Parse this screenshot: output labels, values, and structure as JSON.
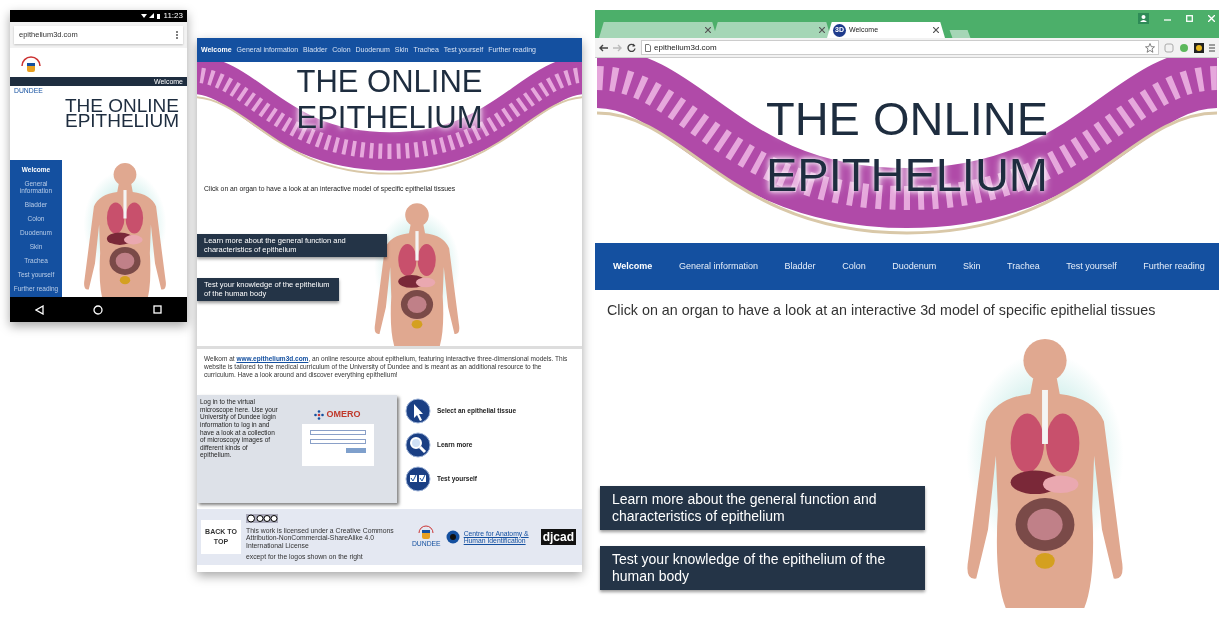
{
  "mobile": {
    "status_time": "11:23",
    "url": "epithelium3d.com",
    "logo_text": "DUNDEE",
    "header_label": "Welcome",
    "title_lines": [
      "THE ONLINE",
      "EPITHELIUM"
    ],
    "menu": [
      {
        "label": "Welcome",
        "selected": true
      },
      {
        "label": "General information",
        "selected": false
      },
      {
        "label": "Bladder",
        "selected": false
      },
      {
        "label": "Colon",
        "selected": false
      },
      {
        "label": "Duodenum",
        "selected": false
      },
      {
        "label": "Skin",
        "selected": false
      },
      {
        "label": "Trachea",
        "selected": false
      },
      {
        "label": "Test yourself",
        "selected": false
      },
      {
        "label": "Further reading",
        "selected": false
      }
    ]
  },
  "tablet": {
    "nav": [
      {
        "label": "Welcome",
        "selected": true
      },
      {
        "label": "General information",
        "selected": false
      },
      {
        "label": "Bladder",
        "selected": false
      },
      {
        "label": "Colon",
        "selected": false
      },
      {
        "label": "Duodenum",
        "selected": false
      },
      {
        "label": "Skin",
        "selected": false
      },
      {
        "label": "Trachea",
        "selected": false
      },
      {
        "label": "Test yourself",
        "selected": false
      },
      {
        "label": "Further reading",
        "selected": false
      }
    ],
    "title_lines": [
      "THE ONLINE",
      "EPITHELIUM"
    ],
    "intro": "Click on an organ to have a look at an interactive model of specific epithelial tissues",
    "cards": [
      "Learn more about the general function and  characteristics of epithelium",
      "Test your knowledge of the epithelium of the human body"
    ],
    "welcome": {
      "before": "Welkom at ",
      "link": "www.epithelium3d.com",
      "after": ", an online resource about epithelium, featuring interactive three-dimensional models. This website is tailored to the medical curriculum of the University of Dundee and is meant as an additional resource to the curriculum. Have a look around and discover everything epithelium!"
    },
    "omero": {
      "text": "Log in to the virtual microscope here. Use your University of Dundee login information to log in and have a look at a collection of microscopy images of different kinds of epithelium.",
      "logo": "OMERO"
    },
    "actions": [
      {
        "kind": "pointer",
        "label": "Select an epithelial tissue"
      },
      {
        "kind": "search",
        "label": "Learn more"
      },
      {
        "kind": "check",
        "label": "Test yourself"
      }
    ],
    "footer": {
      "back_to_top": "BACK TO TOP",
      "license": "This work is licensed under a Creative Commons Attribution-NonCommercial-ShareAlike 4.0 International License",
      "logos_note": "except for the logos shown on the right",
      "dundee": "DUNDEE",
      "cahid": "Centre for Anatomy & Human Identification",
      "djcad": "djcad"
    }
  },
  "desktop": {
    "tabs": [
      {
        "selected": false
      },
      {
        "selected": false
      },
      {
        "title": "Welcome",
        "favicon": "3D",
        "selected": true
      }
    ],
    "url": "epithelium3d.com",
    "title_lines": [
      "THE ONLINE",
      "EPITHELIUM"
    ],
    "nav": [
      {
        "label": "Welcome",
        "selected": true
      },
      {
        "label": "General information",
        "selected": false
      },
      {
        "label": "Bladder",
        "selected": false
      },
      {
        "label": "Colon",
        "selected": false
      },
      {
        "label": "Duodenum",
        "selected": false
      },
      {
        "label": "Skin",
        "selected": false
      },
      {
        "label": "Trachea",
        "selected": false
      },
      {
        "label": "Test yourself",
        "selected": false
      },
      {
        "label": "Further reading",
        "selected": false
      }
    ],
    "intro": "Click on an organ to have a look at an interactive 3d model of specific epithelial tissues",
    "cards": [
      "Learn more about the general function and characteristics of epithelium",
      "Test your knowledge of the epithelium of the human body"
    ]
  }
}
